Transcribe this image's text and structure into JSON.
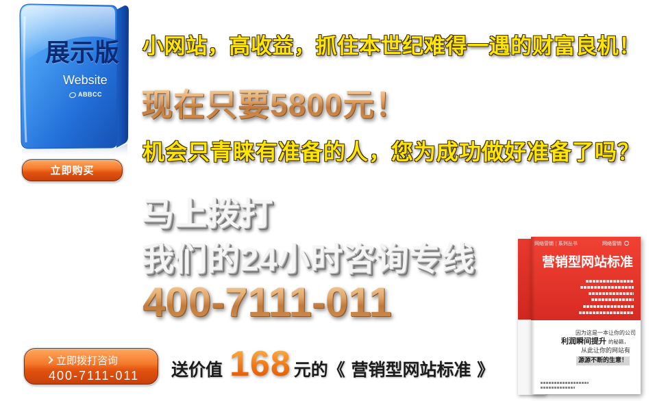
{
  "product_box": {
    "title": "展示版",
    "subtitle": "Website",
    "brand": "ABBCC",
    "logo_icon": "abbcc-logo-icon"
  },
  "buy_button": {
    "label": "立即购买"
  },
  "headline": "小网站，高收益，抓住本世纪难得一遇的财富良机！",
  "price_line": "现在只要5800元！",
  "tagline": "机会只青睐有准备的人，您为成功做好准备了吗？",
  "call_to_action": {
    "line1": "马上拨打",
    "line2": "我们的24小时咨询专线",
    "hotline": "400-7111-011"
  },
  "call_button": {
    "icon": "chevron-right-icon",
    "label": "立即拨打咨询",
    "phone": "400-7111-011"
  },
  "gift": {
    "prefix": "送价值",
    "value": "168",
    "suffix": "元的《 营销型网站标准 》"
  },
  "book": {
    "series_label": "网络营销 | 系列丛书",
    "brand_label": "网络营销",
    "brand_icon": "circle-icon",
    "title": "营销型网站标准",
    "blurb_line1": "因为这是一本让你的公司",
    "blurb_highlight": "利润瞬间提升",
    "blurb_line2_end": "的秘籍，",
    "blurb_line3": "从此让你的网站有",
    "blurb_line4": "源源不断的生意！"
  },
  "colors": {
    "headline_yellow": "#ffe600",
    "price_tan": "#d69a5c",
    "cta_silver": "#f5f5f5",
    "button_orange": "#f06a1e",
    "gift_orange": "#f27612",
    "book_red": "#e3342a",
    "box_blue": "#2a7be4"
  }
}
